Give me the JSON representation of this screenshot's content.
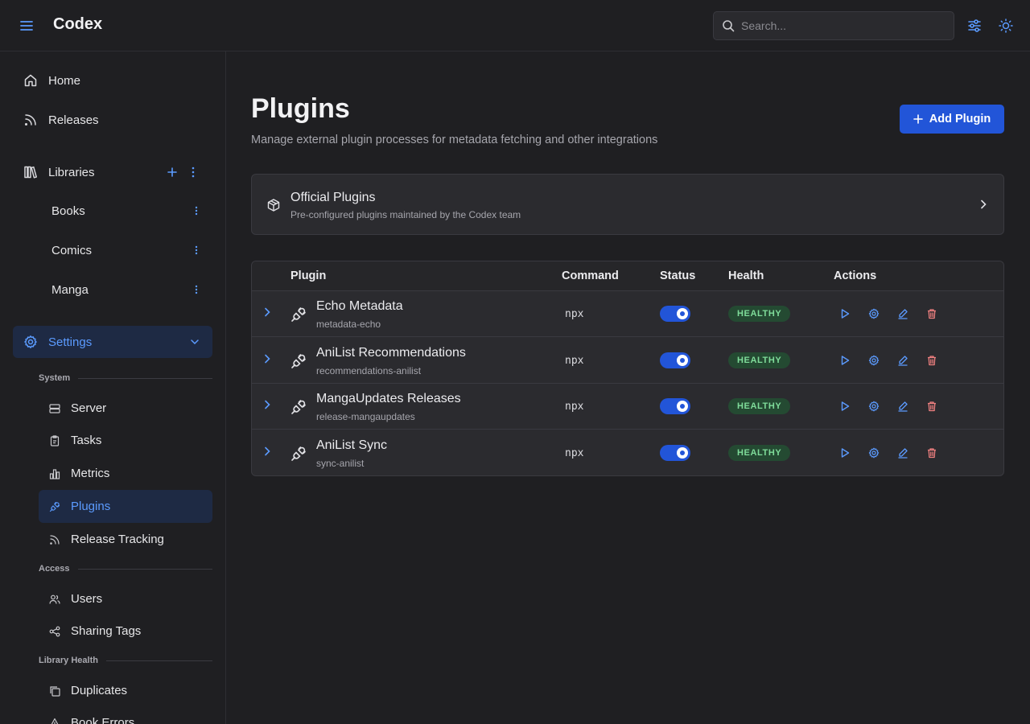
{
  "header": {
    "app_title": "Codex",
    "search_placeholder": "Search...",
    "menu_icon": "hamburger-icon",
    "filter_icon": "sliders-icon",
    "theme_icon": "sun-icon"
  },
  "sidebar": {
    "home_label": "Home",
    "releases_label": "Releases",
    "libraries_label": "Libraries",
    "libraries": [
      {
        "label": "Books"
      },
      {
        "label": "Comics"
      },
      {
        "label": "Manga"
      }
    ],
    "settings_label": "Settings",
    "system_label": "System",
    "system_items": [
      {
        "label": "Server",
        "icon": "server-icon"
      },
      {
        "label": "Tasks",
        "icon": "clipboard-icon"
      },
      {
        "label": "Metrics",
        "icon": "bar-chart-icon"
      },
      {
        "label": "Plugins",
        "icon": "plug-icon"
      },
      {
        "label": "Release Tracking",
        "icon": "rss-icon"
      }
    ],
    "access_label": "Access",
    "access_items": [
      {
        "label": "Users",
        "icon": "users-icon"
      },
      {
        "label": "Sharing Tags",
        "icon": "share-icon"
      }
    ],
    "library_health_label": "Library Health",
    "health_items": [
      {
        "label": "Duplicates",
        "icon": "copy-icon"
      },
      {
        "label": "Book Errors",
        "icon": "alert-triangle-icon"
      }
    ]
  },
  "main": {
    "title": "Plugins",
    "subtitle": "Manage external plugin processes for metadata fetching and other integrations",
    "add_button_label": "Add Plugin",
    "official": {
      "title": "Official Plugins",
      "subtitle": "Pre-configured plugins maintained by the Codex team"
    },
    "table": {
      "columns": {
        "plugin": "Plugin",
        "command": "Command",
        "status": "Status",
        "health": "Health",
        "actions": "Actions"
      },
      "rows": [
        {
          "name": "Echo Metadata",
          "id": "metadata-echo",
          "command": "npx",
          "enabled": true,
          "health": "HEALTHY"
        },
        {
          "name": "AniList Recommendations",
          "id": "recommendations-anilist",
          "command": "npx",
          "enabled": true,
          "health": "HEALTHY"
        },
        {
          "name": "MangaUpdates Releases",
          "id": "release-mangaupdates",
          "command": "npx",
          "enabled": true,
          "health": "HEALTHY"
        },
        {
          "name": "AniList Sync",
          "id": "sync-anilist",
          "command": "npx",
          "enabled": true,
          "health": "HEALTHY"
        }
      ]
    }
  },
  "colors": {
    "accent": "#2255d8",
    "accent_text": "#5b9bff",
    "healthy_bg": "#244a32",
    "healthy_text": "#7fdc9a",
    "delete": "#f08080"
  }
}
